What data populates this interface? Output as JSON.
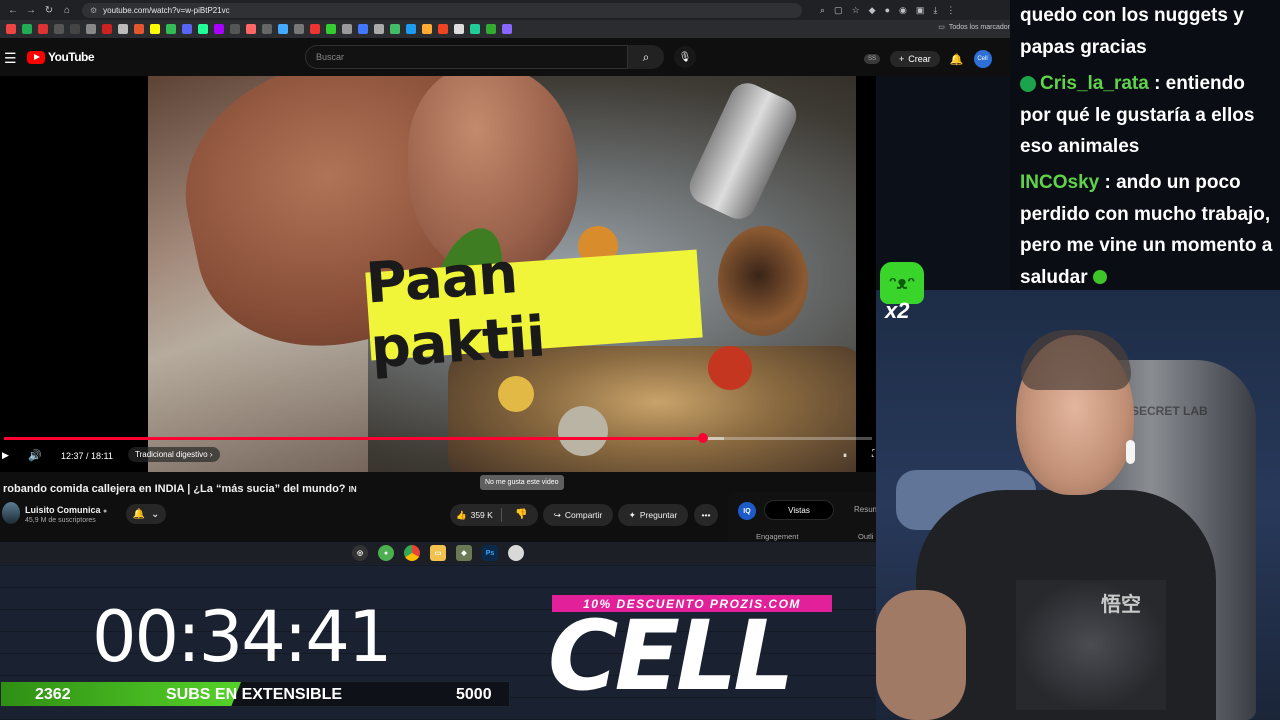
{
  "browser": {
    "url": "youtube.com/watch?v=w-piBtP21vc",
    "bookmarks_all": "Todos los marcador"
  },
  "youtube": {
    "logo": "YouTube",
    "search_placeholder": "Buscar",
    "ss_badge": "SS",
    "create_label": "Crear",
    "avatar_initials": "Cell"
  },
  "video": {
    "overlay_text": "Paan paktii",
    "time": "12:37 / 18:11",
    "chapter": "Tradicional digestivo",
    "progress_played": 0.805,
    "progress_loaded": 0.83
  },
  "details": {
    "title": "robando comida callejera en INDIA | ¿La “más sucia” del mundo?",
    "title_suffix": "IN",
    "tooltip": "No me gusta este video",
    "channel_name": "Luisito Comunica",
    "channel_subs": "45,9 M de suscriptores",
    "likes": "359 K",
    "share_label": "Compartir",
    "ask_label": "Preguntar",
    "side_badge": "IQ",
    "side_tab_active": "Vistas",
    "side_tab_other": "Resum",
    "side_engagement": "Engagement",
    "side_outlier": "Outli"
  },
  "overlay": {
    "timer": "00:34:41",
    "subs_current": "2362",
    "subs_label": "SUBS EN EXTENSIBLE",
    "subs_goal": "5000",
    "subs_progress": 0.4724,
    "promo": "10% DESCUENTO PROZIS.COM",
    "brand": "CELL",
    "emote_multiplier": "x2"
  },
  "chat": [
    {
      "user": "",
      "user_color": "#ffffff",
      "text": "quedo con los nuggets y papas gracias"
    },
    {
      "user": "Cris_la_rata",
      "user_color": "#5fd44a",
      "text": ": entiendo por qué le gustaría a ellos eso animales"
    },
    {
      "user": "INCOsky",
      "user_color": "#5fd44a",
      "text": ": ando un poco perdido con mucho trabajo, pero me vine un momento a saludar"
    }
  ],
  "webcam": {
    "chair_brand": "SECRET LAB",
    "shirt_kanji": "悟空"
  },
  "colors": {
    "youtube_red": "#ff0000",
    "progress_red": "#ff0033",
    "promo_pink": "#e1209a",
    "sub_green": "#56d22a"
  }
}
